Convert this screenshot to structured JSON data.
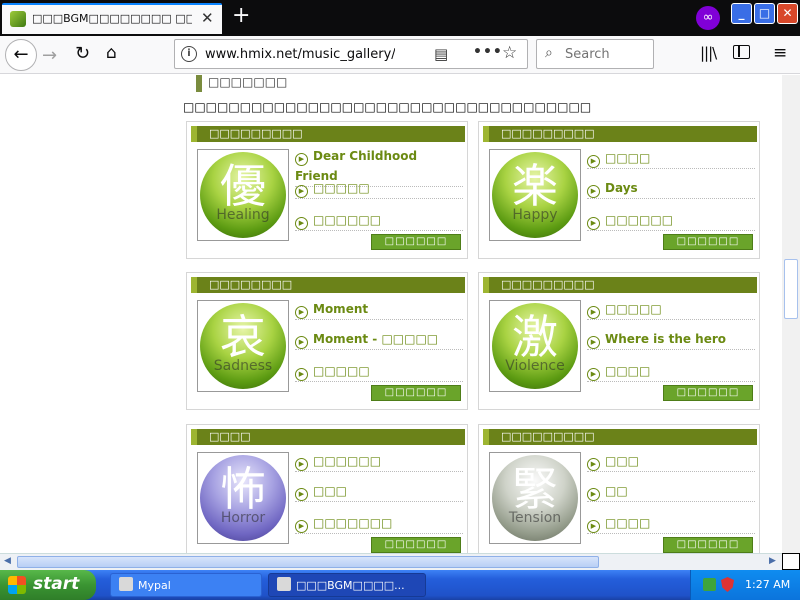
{
  "browser": {
    "tab_title": "□□□BGM□□□□□□□□ □□",
    "tab_close": "✕",
    "new_tab": "+",
    "private_icon": "∞",
    "window_buttons": {
      "minimize": "_",
      "maximize": "□",
      "close": "✕"
    },
    "url": "www.hmix.net/music_gallery/mus",
    "search_placeholder": "Search",
    "icons": {
      "back": "←",
      "forward": "→",
      "reload": "↻",
      "home": "⌂",
      "info": "i",
      "reader": "▤",
      "more": "•••",
      "star": "☆",
      "search": "⌕",
      "library": "|||\\",
      "menu": "≡"
    }
  },
  "page": {
    "subtitle": "□□□□□□□",
    "intro": "□□□□□□□□□□□□□□□□□□□□□□□□□□□□□□□□□□□□",
    "more_label": "□□□□□□",
    "play_glyph": "▶",
    "cards": [
      {
        "header": "□□□□□□□□□",
        "kanji": "優",
        "word": "Healing",
        "orb": "green",
        "tracks": [
          {
            "title": "Dear Childhood Friend"
          },
          {
            "title": "□□□□□"
          },
          {
            "title": "□□□□□□"
          }
        ]
      },
      {
        "header": "□□□□□□□□□",
        "kanji": "楽",
        "word": "Happy",
        "orb": "green",
        "tracks": [
          {
            "title": "□□□□"
          },
          {
            "title": "Days"
          },
          {
            "title": "□□□□□□"
          }
        ]
      },
      {
        "header": "□□□□□□□□",
        "kanji": "哀",
        "word": "Sadness",
        "orb": "green",
        "tracks": [
          {
            "title": "Moment"
          },
          {
            "title": "Moment - □□□□□"
          },
          {
            "title": "□□□□□"
          }
        ]
      },
      {
        "header": "□□□□□□□□□",
        "kanji": "激",
        "word": "Violence",
        "orb": "green",
        "tracks": [
          {
            "title": "□□□□□"
          },
          {
            "title": "Where is the hero"
          },
          {
            "title": "□□□□"
          }
        ]
      },
      {
        "header": "□□□□",
        "kanji": "怖",
        "word": "Horror",
        "orb": "purple",
        "tracks": [
          {
            "title": "□□□□□□"
          },
          {
            "title": "□□□"
          },
          {
            "title": "□□□□□□□"
          }
        ]
      },
      {
        "header": "□□□□□□□□□",
        "kanji": "緊",
        "word": "Tension",
        "orb": "grey",
        "tracks": [
          {
            "title": "□□□"
          },
          {
            "title": "□□"
          },
          {
            "title": "□□□□"
          }
        ]
      }
    ]
  },
  "scrollbars": {
    "left_arrow": "◀",
    "right_arrow": "▶"
  },
  "taskbar": {
    "start_label": "start",
    "tasks": [
      {
        "label": "Mypal"
      },
      {
        "label": "□□□BGM□□□□..."
      }
    ],
    "clock": "1:27 AM"
  }
}
